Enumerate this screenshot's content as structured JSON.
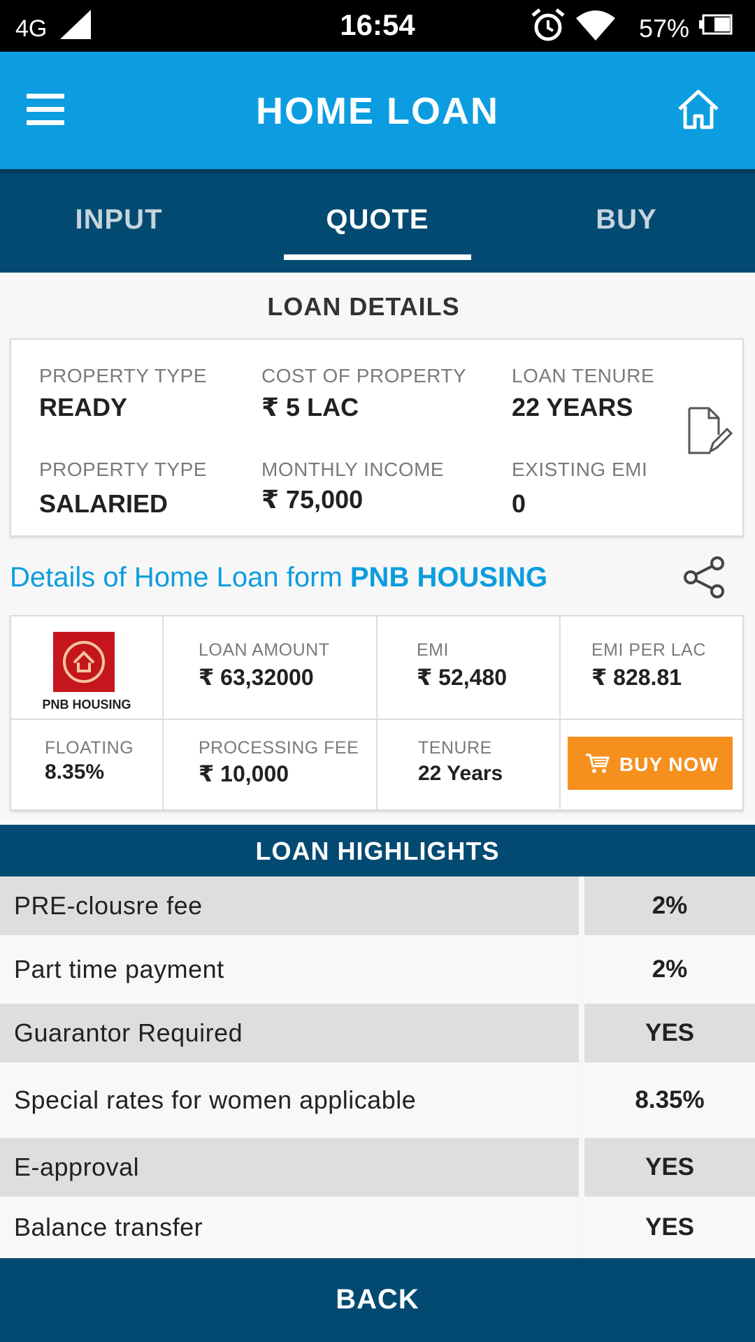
{
  "status_bar": {
    "network": "4G",
    "time": "16:54",
    "battery": "57%"
  },
  "app_bar": {
    "title": "HOME LOAN",
    "menu_icon": "hamburger-menu-icon",
    "home_icon": "home-icon"
  },
  "tabs": [
    {
      "label": "INPUT",
      "active": false
    },
    {
      "label": "QUOTE",
      "active": true
    },
    {
      "label": "BUY",
      "active": false
    }
  ],
  "loan_details": {
    "title": "LOAN DETAILS",
    "items": [
      {
        "label": "PROPERTY TYPE",
        "value": "READY"
      },
      {
        "label": "COST OF PROPERTY",
        "value": "₹ 5 LAC"
      },
      {
        "label": "LOAN TENURE",
        "value": "22 YEARS"
      },
      {
        "label": "PROPERTY TYPE",
        "value": "SALARIED"
      },
      {
        "label": "MONTHLY INCOME",
        "value": "₹ 75,000"
      },
      {
        "label": "EXISTING EMI",
        "value": "0"
      }
    ]
  },
  "details_heading": {
    "prefix": "Details of Home Loan form ",
    "lender": "PNB HOUSING"
  },
  "quote": {
    "logo_text": "PNB HOUSING",
    "loan_amount_label": "LOAN AMOUNT",
    "loan_amount": "₹ 63,32000",
    "emi_label": "EMI",
    "emi": "₹ 52,480",
    "emi_per_lac_label": "EMI PER LAC",
    "emi_per_lac": "₹ 828.81",
    "rate_type": "FLOATING",
    "rate": "8.35%",
    "processing_fee_label": "PROCESSING FEE",
    "processing_fee": "₹ 10,000",
    "tenure_label": "TENURE",
    "tenure": "22 Years",
    "buy_now": "BUY NOW"
  },
  "highlights": {
    "title": "LOAN HIGHLIGHTS",
    "rows": [
      {
        "name": "PRE-clousre fee",
        "value": "2%"
      },
      {
        "name": "Part time payment",
        "value": "2%"
      },
      {
        "name": "Guarantor Required",
        "value": "YES"
      },
      {
        "name": "Special rates for women applicable",
        "value": "8.35%"
      },
      {
        "name": "E-approval",
        "value": "YES"
      },
      {
        "name": "Balance transfer",
        "value": "YES"
      }
    ]
  },
  "back_label": "BACK",
  "colors": {
    "primary": "#0b9ddf",
    "dark": "#034a72",
    "accent": "#f5901e"
  }
}
